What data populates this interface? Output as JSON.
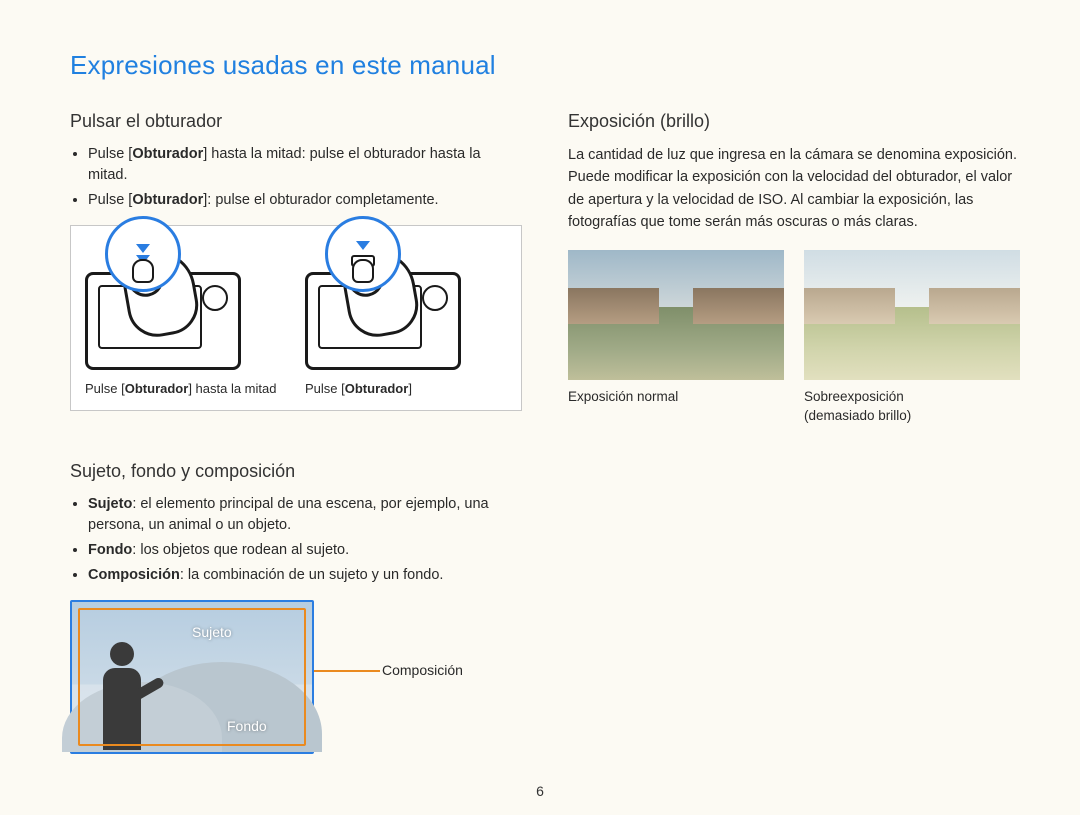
{
  "title": "Expresiones usadas en este manual",
  "page_number": "6",
  "left": {
    "section1": {
      "heading": "Pulsar el obturador",
      "bullet1_pre": "Pulse [",
      "bullet1_bold": "Obturador",
      "bullet1_post": "] hasta la mitad: pulse el obturador hasta la mitad.",
      "bullet2_pre": "Pulse [",
      "bullet2_bold": "Obturador",
      "bullet2_post": "]: pulse el obturador completamente.",
      "fig1_pre": "Pulse [",
      "fig1_bold": "Obturador",
      "fig1_post": "] hasta la mitad",
      "fig2_pre": "Pulse [",
      "fig2_bold": "Obturador",
      "fig2_post": "]"
    },
    "section2": {
      "heading": "Sujeto, fondo y composición",
      "b1_bold": "Sujeto",
      "b1_rest": ": el elemento principal de una escena, por ejemplo, una persona, un animal o un objeto.",
      "b2_bold": "Fondo",
      "b2_rest": ": los objetos que rodean al sujeto.",
      "b3_bold": "Composición",
      "b3_rest": ": la combinación de un sujeto y un fondo.",
      "label_subject": "Sujeto",
      "label_background": "Fondo",
      "label_composition": "Composición"
    }
  },
  "right": {
    "heading": "Exposición (brillo)",
    "paragraph": "La cantidad de luz que ingresa en la cámara se denomina exposición. Puede modificar la exposición con la velocidad del obturador, el valor de apertura y la velocidad de ISO. Al cambiar la exposición, las fotografías que tome serán más oscuras o más claras.",
    "cap_normal": "Exposición normal",
    "cap_over_line1": "Sobreexposición",
    "cap_over_line2": "(demasiado brillo)"
  }
}
